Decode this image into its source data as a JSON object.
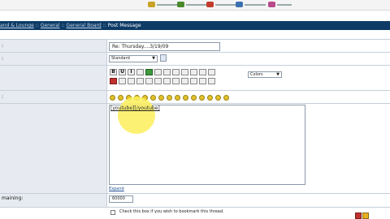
{
  "nav": {
    "colors": [
      "#c9a227",
      "#4a8a2a",
      "#c33c2b",
      "#3a6fb0",
      "#b84a8a",
      "#4a8a2a",
      "#c9a227"
    ]
  },
  "breadcrumb": {
    "items": [
      "and & Lounge",
      "General",
      "General Board"
    ],
    "separator": "::",
    "current": "Post Message"
  },
  "form": {
    "subject_value": "Re:  Thursday....3/19/09",
    "icon_select": "Standard",
    "colors_select": "Colors",
    "message_label_fragment": "maining:",
    "message_content": "[youtube][/youtube]",
    "message_tag_open": "[youtube]",
    "message_tag_close": "[/youtube]",
    "expand_link": "Expand",
    "chars_remaining": "60000",
    "bookmark_label": "Check this box if you wish to bookmark this thread."
  },
  "toolbar": {
    "row1": [
      {
        "name": "bold-button",
        "label": "B",
        "style": ""
      },
      {
        "name": "underline-button",
        "label": "U",
        "style": ""
      },
      {
        "name": "italic-button",
        "label": "I",
        "style": ""
      },
      {
        "name": "strike-button",
        "label": "",
        "style": ""
      },
      {
        "name": "color-button",
        "label": "",
        "style": "grn"
      },
      {
        "name": "sub-button",
        "label": "",
        "style": ""
      },
      {
        "name": "align-left-button",
        "label": "",
        "style": ""
      },
      {
        "name": "align-center-button",
        "label": "",
        "style": ""
      },
      {
        "name": "align-right-button",
        "label": "",
        "style": ""
      },
      {
        "name": "justify-button",
        "label": "",
        "style": ""
      },
      {
        "name": "list-button",
        "label": "",
        "style": ""
      },
      {
        "name": "indent-button",
        "label": "",
        "style": ""
      }
    ],
    "row2": [
      {
        "name": "youtube-button",
        "label": "",
        "style": "red"
      },
      {
        "name": "hr-button",
        "label": "",
        "style": ""
      },
      {
        "name": "link-button",
        "label": "",
        "style": ""
      },
      {
        "name": "image-button",
        "label": "",
        "style": ""
      },
      {
        "name": "table-button",
        "label": "",
        "style": ""
      },
      {
        "name": "grid-button",
        "label": "",
        "style": ""
      },
      {
        "name": "quote-button",
        "label": "",
        "style": ""
      },
      {
        "name": "code-button",
        "label": "",
        "style": ""
      },
      {
        "name": "email-button",
        "label": "",
        "style": ""
      },
      {
        "name": "flash-button",
        "label": "",
        "style": ""
      },
      {
        "name": "media-button",
        "label": "",
        "style": ""
      },
      {
        "name": "spoiler-button",
        "label": "",
        "style": ""
      }
    ],
    "smilies_count": 15
  }
}
